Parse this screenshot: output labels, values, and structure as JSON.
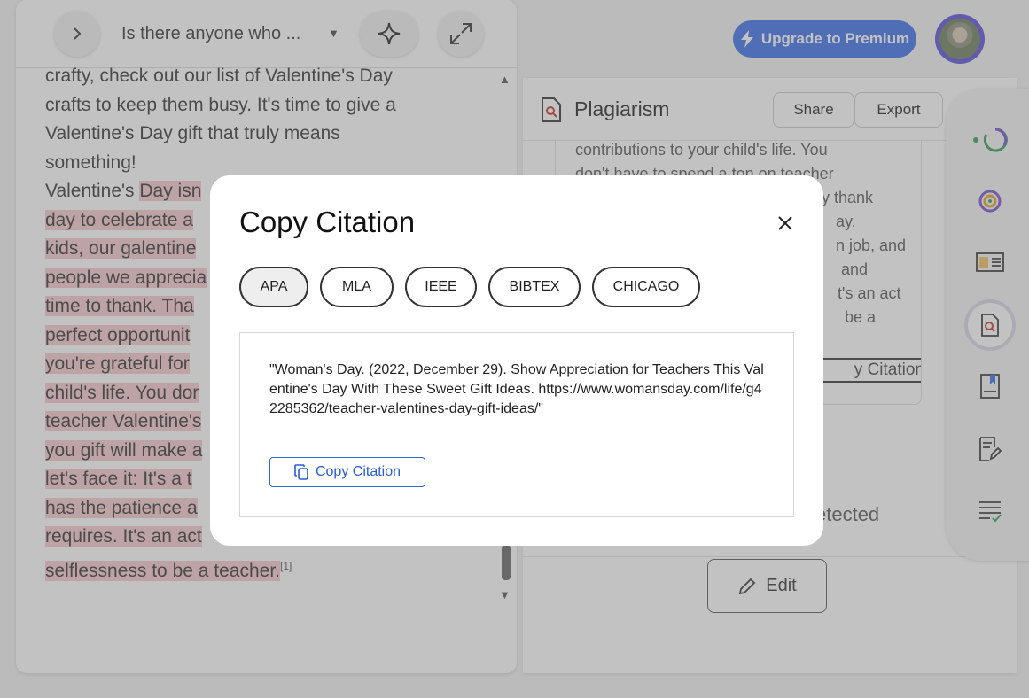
{
  "left": {
    "toolbar": {
      "title": "Is there anyone who ...",
      "icons": [
        "chevron-right-icon",
        "caret-down-icon",
        "sparkle-icon",
        "expand-icon"
      ]
    },
    "document": {
      "lines": [
        {
          "text": "crafty, check out our list of Valentine's Day",
          "highlight": false
        },
        {
          "text": "crafts to keep them busy. It's time to give a",
          "highlight": false
        },
        {
          "text": "Valentine's Day gift that truly means",
          "highlight": false
        },
        {
          "text": "something!",
          "highlight": false
        }
      ],
      "highlighted_start_plain": "Valentine's ",
      "highlighted_start_hl": "Day isn",
      "highlighted_lines": [
        "day to celebrate a",
        "kids, our galentine",
        "people we apprecia",
        "time to thank. Tha",
        "perfect opportunit",
        "you're grateful for",
        "child's life. You dor",
        "teacher Valentine's",
        "you gift will make a",
        "let's face it: It's a t",
        "has the patience a",
        "requires. It's an act",
        "selflessness to be a teacher."
      ],
      "citation_marker": "[1]"
    }
  },
  "header": {
    "premium_label": "Upgrade to Premium",
    "avatar": "user-avatar"
  },
  "plagiarism": {
    "title": "Plagiarism",
    "share_label": "Share",
    "export_label": "Export",
    "card_lines": [
      "contributions to your child's life. You",
      "don't have to spend a ton on teacher",
      "y thank",
      "ay.",
      "n job, and",
      "and",
      "t's an act",
      "be a"
    ],
    "card_copy_label": "y Citation",
    "detected_label": "etected",
    "edit_label": "Edit"
  },
  "sidebar": {
    "items": [
      "progress-ring-icon",
      "target-icon",
      "ab-card-icon",
      "plagiarism-search-icon",
      "bookmark-doc-icon",
      "edit-doc-icon",
      "checklist-icon"
    ]
  },
  "modal": {
    "title": "Copy Citation",
    "formats": [
      "APA",
      "MLA",
      "IEEE",
      "BIBTEX",
      "CHICAGO"
    ],
    "active_format": "APA",
    "citation_text": "\"Woman's Day. (2022, December 29). Show Appreciation for Teachers This Valentine's Day With These Sweet Gift Ideas. https://www.womansday.com/life/g42285362/teacher-valentines-day-gift-ideas/\"",
    "copy_button_label": "Copy Citation",
    "colors": {
      "accent": "#3b6fe8",
      "highlight": "#f7c9cf",
      "link": "#2a5bd7"
    }
  }
}
